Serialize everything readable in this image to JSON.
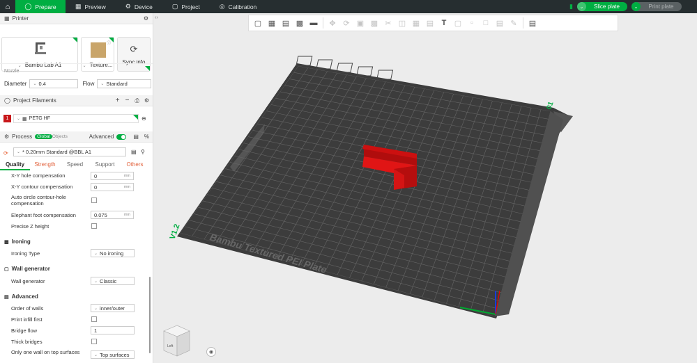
{
  "topbar": {
    "tabs": [
      {
        "label": "Prepare",
        "icon": "prepare-icon"
      },
      {
        "label": "Preview",
        "icon": "preview-icon"
      },
      {
        "label": "Device",
        "icon": "device-icon"
      },
      {
        "label": "Project",
        "icon": "project-icon"
      },
      {
        "label": "Calibration",
        "icon": "calibration-icon"
      }
    ],
    "slice_label": "Slice plate",
    "print_label": "Print plate"
  },
  "printer": {
    "section_title": "Printer",
    "printer_name": "Bambu Lab A1",
    "plate_name": "Texture...",
    "sync_label": "Sync info",
    "nozzle_label": "Nozzle",
    "diameter_label": "Diameter",
    "diameter_value": "0.4",
    "flow_label": "Flow",
    "flow_value": "Standard"
  },
  "filaments": {
    "section_title": "Project Filaments",
    "items": [
      {
        "index": "1",
        "name": "PETG HF",
        "color": "#c8171a"
      }
    ]
  },
  "process": {
    "section_title": "Process",
    "global_label": "Global",
    "objects_label": "Objects",
    "advanced_label": "Advanced",
    "preset": "* 0.20mm Standard @BBL A1",
    "tabs": [
      "Quality",
      "Strength",
      "Speed",
      "Support",
      "Others"
    ],
    "params": [
      {
        "label": "X-Y hole compensation",
        "value": "0",
        "unit": "mm"
      },
      {
        "label": "X-Y contour compensation",
        "value": "0",
        "unit": "mm"
      },
      {
        "label": "Auto circle contour-hole compensation",
        "value": ""
      },
      {
        "label": "Elephant foot compensation",
        "value": "0.075",
        "unit": "mm"
      },
      {
        "label": "Precise Z height",
        "value": ""
      }
    ],
    "ironing_group": "Ironing",
    "ironing_type_label": "Ironing Type",
    "ironing_type_value": "No ironing",
    "wall_group": "Wall generator",
    "wall_label": "Wall generator",
    "wall_value": "Classic",
    "advanced_group": "Advanced",
    "order_label": "Order of walls",
    "order_value": "inner/outer",
    "infill_first_label": "Print infill first",
    "bridge_flow_label": "Bridge flow",
    "bridge_flow_value": "1",
    "thick_bridges_label": "Thick bridges",
    "one_wall_label": "Only one wall on top surfaces",
    "one_wall_value": "Top surfaces"
  },
  "plate": {
    "name_text": "Bambu Textured PEI Plate",
    "corner_label_left": "V1.2",
    "corner_label_right": "01",
    "accent": "#00ae42",
    "object_color": "#cc1010"
  },
  "viewcube": {
    "face_label": "Left"
  }
}
